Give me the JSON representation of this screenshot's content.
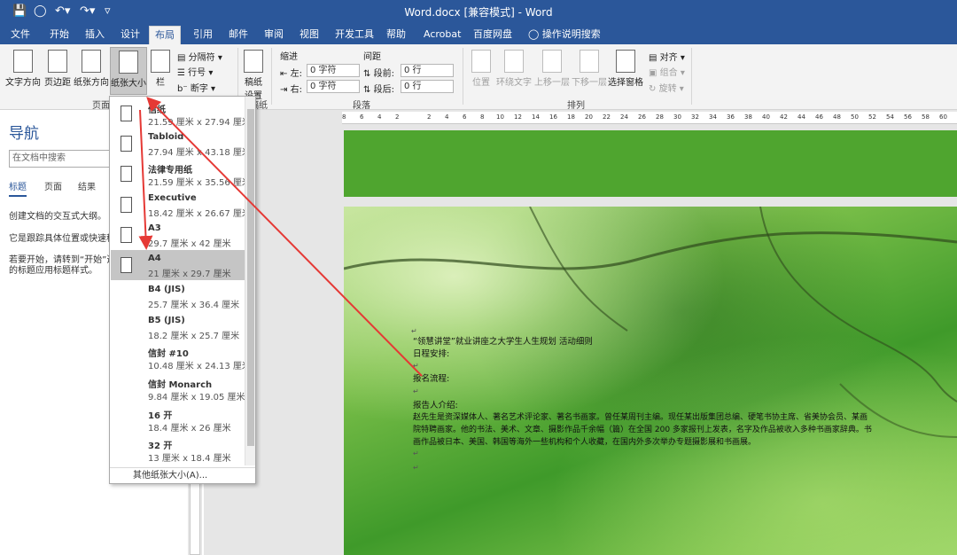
{
  "window": {
    "title": "Word.docx [兼容模式] - Word"
  },
  "tabs": [
    "文件",
    "开始",
    "插入",
    "设计",
    "布局",
    "引用",
    "邮件",
    "审阅",
    "视图",
    "开发工具",
    "帮助",
    "Acrobat",
    "百度网盘"
  ],
  "tell_me": "操作说明搜索",
  "ribbon": {
    "page_setup": {
      "text_direction": "文字方向",
      "margins": "页边距",
      "orientation": "纸张方向",
      "size": "纸张大小",
      "columns": "栏",
      "breaks": "分隔符",
      "line_numbers": "行号",
      "hyphenation": "断字",
      "group_label": "页面"
    },
    "manuscript": {
      "label": "稿纸",
      "label2": "设置",
      "group_label": "稿纸"
    },
    "paragraph": {
      "indent_label": "缩进",
      "spacing_label": "间距",
      "left_label": "左:",
      "right_label": "右:",
      "before_label": "段前:",
      "after_label": "段后:",
      "left_value": "0 字符",
      "right_value": "0 字符",
      "before_value": "0 行",
      "after_value": "0 行",
      "group_label": "段落"
    },
    "arrange": {
      "position": "位置",
      "wrap_text": "环绕文字",
      "bring_forward": "上移一层",
      "send_backward": "下移一层",
      "selection_pane": "选择窗格",
      "align": "对齐",
      "group": "组合",
      "rotate": "旋转",
      "group_label": "排列"
    }
  },
  "nav": {
    "title": "导航",
    "search_placeholder": "在文档中搜索",
    "tabs": [
      "标题",
      "页面",
      "结果"
    ],
    "lines": [
      "创建文档的交互式大纲。",
      "它是跟踪具体位置或快速移",
      "若要开始，请转到“开始”选",
      "的标题应用标题样式。"
    ]
  },
  "ruler": {
    "ticks": [
      "8",
      "6",
      "4",
      "2",
      "2",
      "4",
      "6",
      "8",
      "10",
      "12",
      "14",
      "16",
      "18",
      "20",
      "22",
      "24",
      "26",
      "28",
      "30",
      "32",
      "34",
      "36",
      "38",
      "40",
      "42",
      "44",
      "46",
      "48",
      "50",
      "52",
      "54",
      "56",
      "58",
      "60"
    ]
  },
  "paper_menu": {
    "items": [
      {
        "name": "信纸",
        "size": "21.59 厘米 x 27.94 厘米"
      },
      {
        "name": "Tabloid",
        "size": "27.94 厘米 x 43.18 厘米"
      },
      {
        "name": "法律专用纸",
        "size": "21.59 厘米 x 35.56 厘米"
      },
      {
        "name": "Executive",
        "size": "18.42 厘米 x 26.67 厘米"
      },
      {
        "name": "A3",
        "size": "29.7 厘米 x 42 厘米"
      },
      {
        "name": "A4",
        "size": "21 厘米 x 29.7 厘米"
      },
      {
        "name": "B4 (JIS)",
        "size": "25.7 厘米 x 36.4 厘米"
      },
      {
        "name": "B5 (JIS)",
        "size": "18.2 厘米 x 25.7 厘米"
      },
      {
        "name": "信封 #10",
        "size": "10.48 厘米 x 24.13 厘米"
      },
      {
        "name": "信封 Monarch",
        "size": "9.84 厘米 x 19.05 厘米"
      },
      {
        "name": "16 开",
        "size": "18.4 厘米 x 26 厘米"
      },
      {
        "name": "32 开",
        "size": "13 厘米 x 18.4 厘米"
      }
    ],
    "selected": "A4",
    "more": "其他纸张大小(A)..."
  },
  "document": {
    "line1": "“领慧讲堂”就业讲座之大学生人生规划 活动细则",
    "line2": "日程安排:",
    "line3": "报名流程:",
    "line4": "报告人介绍:",
    "line5": "赵先生是资深媒体人、著名艺术评论家、著名书画家。曾任某周刊主编。现任某出版集团总编、硬笔书协主席、省美协会员、某画",
    "line6": "院特聘画家。他的书法、美术、文章、摄影作品千余幅（篇）在全国 200 多家报刊上发表，名字及作品被收入多种书画家辞典。书",
    "line7": "画作品被日本、美国、韩国等海外一些机构和个人收藏，在国内外多次举办专题摄影展和书画展。"
  },
  "colors": {
    "accent": "#2b579a",
    "arrow": "#e53935",
    "page_green": "#4fa52f"
  }
}
